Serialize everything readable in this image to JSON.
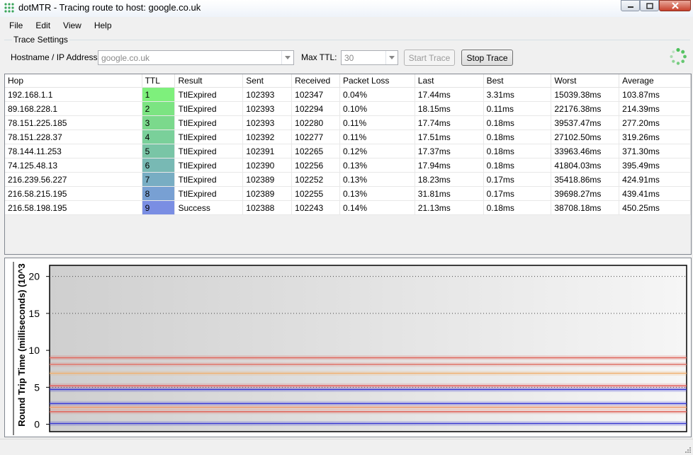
{
  "window": {
    "title": "dotMTR - Tracing route to host: google.co.uk",
    "app_icon": "grid-dots-icon",
    "controls": [
      "minimize-icon",
      "maximize-icon",
      "close-icon"
    ]
  },
  "menu": {
    "items": [
      "File",
      "Edit",
      "View",
      "Help"
    ]
  },
  "settings": {
    "group_label": "Trace Settings",
    "hostname_label": "Hostname / IP Address:",
    "hostname_value": "google.co.uk",
    "maxttl_label": "Max TTL:",
    "maxttl_value": "30",
    "start_label": "Start Trace",
    "stop_label": "Stop Trace"
  },
  "table": {
    "columns": [
      "Hop",
      "TTL",
      "Result",
      "Sent",
      "Received",
      "Packet Loss",
      "Last",
      "Best",
      "Worst",
      "Average"
    ],
    "rows": [
      {
        "hop": "192.168.1.1",
        "ttl": "1",
        "result": "TtlExpired",
        "sent": "102393",
        "received": "102347",
        "loss": "0.04%",
        "last": "17.44ms",
        "best": "3.31ms",
        "worst": "15039.38ms",
        "average": "103.87ms",
        "color": "#7ef07c"
      },
      {
        "hop": "89.168.228.1",
        "ttl": "2",
        "result": "TtlExpired",
        "sent": "102393",
        "received": "102294",
        "loss": "0.10%",
        "last": "18.15ms",
        "best": "0.11ms",
        "worst": "22176.38ms",
        "average": "214.39ms",
        "color": "#7ce482"
      },
      {
        "hop": "78.151.225.185",
        "ttl": "3",
        "result": "TtlExpired",
        "sent": "102393",
        "received": "102280",
        "loss": "0.11%",
        "last": "17.74ms",
        "best": "0.18ms",
        "worst": "39537.47ms",
        "average": "277.20ms",
        "color": "#7bd98c"
      },
      {
        "hop": "78.151.228.37",
        "ttl": "4",
        "result": "TtlExpired",
        "sent": "102392",
        "received": "102277",
        "loss": "0.11%",
        "last": "17.51ms",
        "best": "0.18ms",
        "worst": "27102.50ms",
        "average": "319.26ms",
        "color": "#7ad09a"
      },
      {
        "hop": "78.144.11.253",
        "ttl": "5",
        "result": "TtlExpired",
        "sent": "102391",
        "received": "102265",
        "loss": "0.12%",
        "last": "17.37ms",
        "best": "0.18ms",
        "worst": "33963.46ms",
        "average": "371.30ms",
        "color": "#79c5a6"
      },
      {
        "hop": "74.125.48.13",
        "ttl": "6",
        "result": "TtlExpired",
        "sent": "102390",
        "received": "102256",
        "loss": "0.13%",
        "last": "17.94ms",
        "best": "0.18ms",
        "worst": "41804.03ms",
        "average": "395.49ms",
        "color": "#78b9b4"
      },
      {
        "hop": "216.239.56.227",
        "ttl": "7",
        "result": "TtlExpired",
        "sent": "102389",
        "received": "102252",
        "loss": "0.13%",
        "last": "18.23ms",
        "best": "0.17ms",
        "worst": "35418.86ms",
        "average": "424.91ms",
        "color": "#78adc3"
      },
      {
        "hop": "216.58.215.195",
        "ttl": "8",
        "result": "TtlExpired",
        "sent": "102389",
        "received": "102255",
        "loss": "0.13%",
        "last": "31.81ms",
        "best": "0.17ms",
        "worst": "39698.27ms",
        "average": "439.41ms",
        "color": "#78a0d3"
      },
      {
        "hop": "216.58.198.195",
        "ttl": "9",
        "result": "Success",
        "sent": "102388",
        "received": "102243",
        "loss": "0.14%",
        "last": "21.13ms",
        "best": "0.18ms",
        "worst": "38708.18ms",
        "average": "450.25ms",
        "color": "#7a8ee3"
      }
    ]
  },
  "chart_data": {
    "type": "line",
    "ylabel": "Round Trip Time (milliseconds) (10^3",
    "yticks": [
      "0",
      "5",
      "10",
      "15",
      "20"
    ],
    "ylim": [
      -1,
      21.5
    ],
    "grid": "horizontal dotted at 5, 15, 20",
    "series": [
      {
        "color": "#e06a60",
        "values": [
          9.0,
          9.0
        ]
      },
      {
        "color": "#e07a70",
        "values": [
          8.1,
          8.1
        ]
      },
      {
        "color": "#f0b070",
        "values": [
          6.9,
          6.9
        ]
      },
      {
        "color": "#e05a5a",
        "values": [
          5.2,
          5.2
        ]
      },
      {
        "color": "#3a3ad0",
        "values": [
          4.7,
          4.7
        ]
      },
      {
        "color": "#4040d8",
        "values": [
          2.8,
          2.8
        ]
      },
      {
        "color": "#f09a70",
        "values": [
          2.3,
          2.3
        ]
      },
      {
        "color": "#e06a60",
        "values": [
          1.7,
          1.7
        ]
      },
      {
        "color": "#3a3ad0",
        "values": [
          0.1,
          0.1
        ]
      }
    ]
  }
}
